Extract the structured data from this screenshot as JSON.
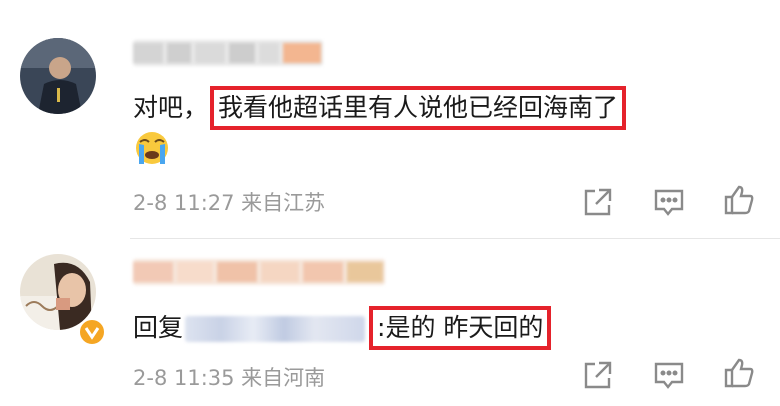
{
  "comments": [
    {
      "avatar_icon": "user-avatar",
      "text_prefix": "对吧，",
      "text_highlight": "我看他超话里有人说他已经回海南了",
      "emoji_icon": "crying-face-emoji",
      "meta": "2-8 11:27  来自江苏"
    },
    {
      "avatar_icon": "user-avatar",
      "badge_icon": "verified-badge-icon",
      "reply_prefix": "回复",
      "text_highlight": ":是的 昨天回的",
      "meta": "2-8 11:35  来自河南"
    }
  ],
  "actions": [
    "share-icon",
    "comment-icon",
    "like-icon"
  ],
  "colors": {
    "highlight_border": "#e5222b",
    "meta_text": "#9a9a9a",
    "badge": "#f5a623"
  }
}
